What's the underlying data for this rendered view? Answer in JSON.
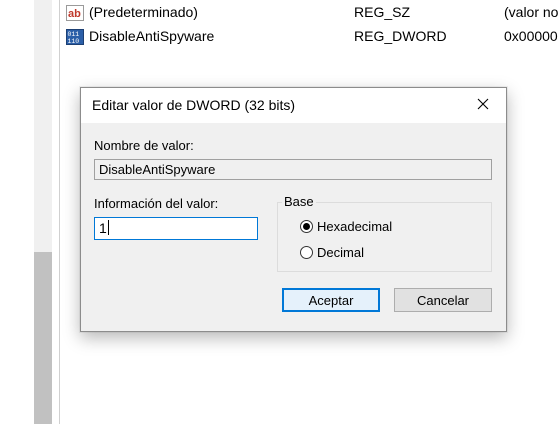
{
  "values": [
    {
      "name": "(Predeterminado)",
      "type": "REG_SZ",
      "data": "(valor no",
      "icon": "string-value-icon"
    },
    {
      "name": "DisableAntiSpyware",
      "type": "REG_DWORD",
      "data": "0x00000",
      "icon": "binary-value-icon"
    }
  ],
  "dialog": {
    "title": "Editar valor de DWORD (32 bits)",
    "value_name_label": "Nombre de valor:",
    "value_name": "DisableAntiSpyware",
    "value_data_label": "Información del valor:",
    "value_data": "1",
    "base_label": "Base",
    "base_options": [
      {
        "label": "Hexadecimal",
        "selected": true
      },
      {
        "label": "Decimal",
        "selected": false
      }
    ],
    "ok_label": "Aceptar",
    "cancel_label": "Cancelar"
  },
  "colors": {
    "focus_accent": "#0078d7",
    "dialog_background": "#f0f0f0",
    "string_icon_red": "#c0392b",
    "binary_icon_blue": "#2b5fa8"
  }
}
